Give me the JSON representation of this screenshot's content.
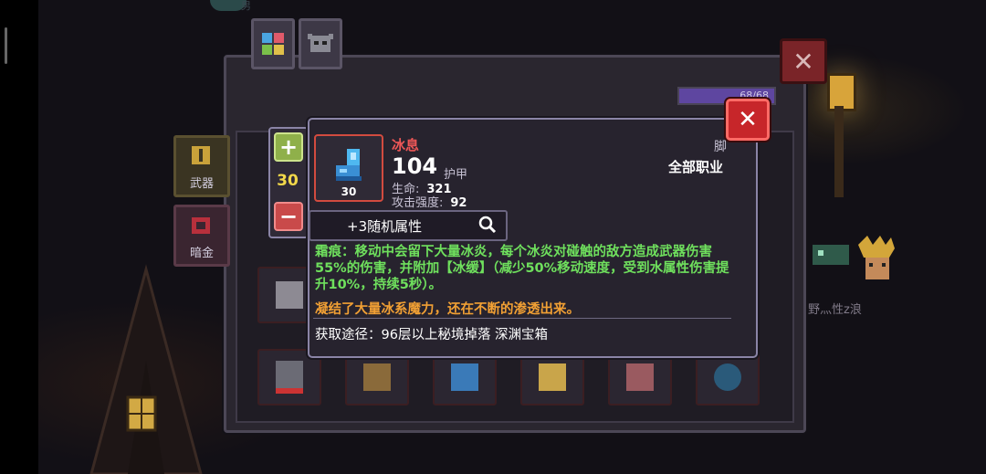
{
  "background": {
    "hero_partial_text": "男",
    "npc_name": "乀野灬性z浪"
  },
  "panel": {
    "xp_text": "68/68",
    "side_buttons": [
      {
        "label": "武器"
      },
      {
        "label": "暗金"
      }
    ]
  },
  "item": {
    "name": "冰息",
    "power": "104",
    "type": "护甲",
    "level": "30",
    "stats": [
      {
        "label": "生命:",
        "value": "321"
      },
      {
        "label": "攻击强度:",
        "value": "92"
      }
    ],
    "slot": "脚",
    "class": "全部职业",
    "random_attr": "+3随机属性",
    "description": "霜痕：移动中会留下大量冰炎，每个冰炎对碰触的敌方造成武器伤害55%的伤害，并附加【冰缓】（减少50%移动速度，受到水属性伤害提升10%，持续5秒）。",
    "flavor": "凝结了大量冰系魔力，还在不断的渗透出来。",
    "source": "获取途径：96层以上秘境掉落 深渊宝箱"
  },
  "level_control": {
    "value": "30"
  },
  "colors": {
    "item_name": "#ee5757",
    "description": "#6fe05d",
    "flavor": "#f1a034",
    "level": "#f2d84a"
  },
  "icons": [
    "close-icon",
    "plus-icon",
    "minus-icon",
    "magnifier-icon",
    "boot-icon",
    "color-grid-icon",
    "helmet-icon",
    "weapon-icon",
    "chest-icon"
  ]
}
